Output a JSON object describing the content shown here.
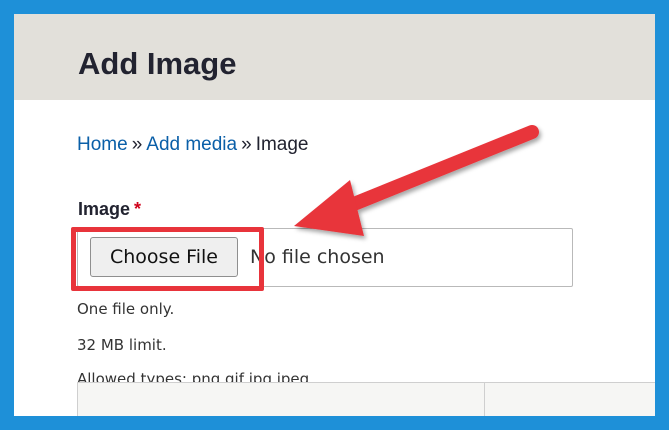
{
  "header": {
    "title": "Add Image"
  },
  "breadcrumb": {
    "items": [
      "Home",
      "Add media",
      "Image"
    ],
    "separator": "»"
  },
  "field": {
    "label": "Image",
    "required_mark": "*",
    "choose_button_label": "Choose File",
    "status": "No file chosen",
    "descriptions": [
      "One file only.",
      "32 MB limit.",
      "Allowed types: png gif jpg jpeg."
    ]
  },
  "annotation": {
    "color": "#e8343b",
    "highlight": "choose-file-button",
    "arrow_icon": "arrow-pointing-left"
  },
  "colors": {
    "border": "#1e90d8",
    "header_background": "#e2e0da",
    "link": "#0a5fa8",
    "required": "#d0021b"
  }
}
